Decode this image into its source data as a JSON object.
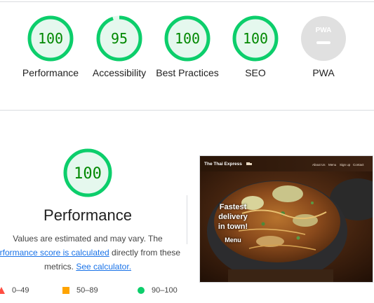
{
  "summary": {
    "gauges": [
      {
        "score": "100",
        "label": "Performance",
        "color": "#0cce6b"
      },
      {
        "score": "95",
        "label": "Accessibility",
        "color": "#0cce6b",
        "fraction": 0.95
      },
      {
        "score": "100",
        "label": "Best Practices",
        "color": "#0cce6b"
      },
      {
        "score": "100",
        "label": "SEO",
        "color": "#0cce6b"
      },
      {
        "score": "PWA",
        "label": "PWA",
        "color": "#e0e0e0"
      }
    ]
  },
  "performance": {
    "score": "100",
    "title": "Performance",
    "desc_line1": "Values are estimated and may vary. The",
    "link_score": "erformance score is calculated",
    "desc_after_link": " directly from these",
    "desc_metrics": "metrics. ",
    "link_calculator": "See calculator.",
    "legend": [
      {
        "range": "0–49",
        "color": "#ff4e42",
        "shape": "triangle"
      },
      {
        "range": "50–89",
        "color": "#ffa400",
        "shape": "square"
      },
      {
        "range": "90–100",
        "color": "#0cce6b",
        "shape": "circle"
      }
    ]
  },
  "screenshot": {
    "brand": "The Thai Express",
    "nav_links": [
      "About Us",
      "Menu",
      "Sign up",
      "Contact"
    ],
    "headline_1": "Fastest",
    "headline_2": "delivery",
    "headline_3": "in town!",
    "menu_label": "Menu"
  },
  "colors": {
    "pass": "#0cce6b",
    "pass_bg": "#e5f8ee",
    "pass_text": "#008800",
    "link": "#1a73e8"
  }
}
